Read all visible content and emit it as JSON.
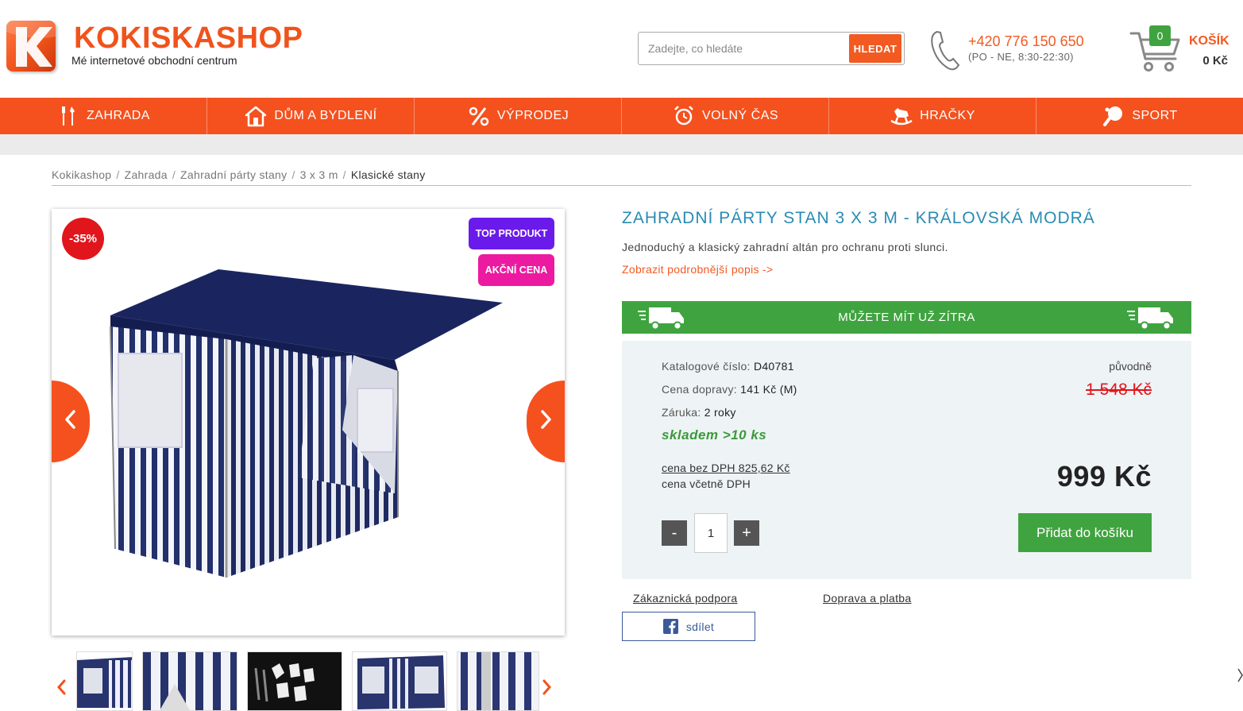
{
  "header": {
    "logo_name": "KOKISKASHOP",
    "logo_tagline": "Mé internetové obchodní centrum",
    "search_placeholder": "Zadejte, co hledáte",
    "search_button": "HLEDAT",
    "phone": "+420 776 150 650",
    "phone_hours": "(PO - NE, 8:30-22:30)",
    "cart_count": "0",
    "cart_label": "KOŠÍK",
    "cart_total": "0 Kč"
  },
  "nav": [
    {
      "label": "ZAHRADA",
      "icon": "garden-tools-icon"
    },
    {
      "label": "DŮM A BYDLENÍ",
      "icon": "house-icon"
    },
    {
      "label": "VÝPRODEJ",
      "icon": "percent-icon"
    },
    {
      "label": "VOLNÝ ČAS",
      "icon": "alarm-clock-icon"
    },
    {
      "label": "HRAČKY",
      "icon": "rocking-horse-icon"
    },
    {
      "label": "SPORT",
      "icon": "ping-pong-icon"
    }
  ],
  "breadcrumb": [
    "Kokikashop",
    "Zahrada",
    "Zahradní párty stany",
    "3 x 3 m",
    "Klasické stany"
  ],
  "gallery": {
    "discount_badge": "-35%",
    "top_badge": "TOP PRODUKT",
    "action_badge": "AKČNÍ CENA",
    "prev_icon": "chevron-left-icon",
    "next_icon": "chevron-right-icon"
  },
  "product": {
    "title": "ZAHRADNÍ PÁRTY STAN 3 X 3 M - KRÁLOVSKÁ MODRÁ",
    "short_description": "Jednoduchý a klasický zahradní altán pro ochranu proti slunci.",
    "more_link": "Zobrazit podrobnější popis ->",
    "delivery_banner": "MŮŽETE MÍT UŽ ZÍTRA",
    "catalog_label": "Katalogové číslo:",
    "catalog_value": "D40781",
    "shipping_label": "Cena dopravy:",
    "shipping_value": "141 Kč (M)",
    "warranty_label": "Záruka:",
    "warranty_value": "2 roky",
    "stock": "skladem >10 ks",
    "original_label": "původně",
    "original_price": "1 548 Kč",
    "price_no_vat": "cena bez DPH 825,62 Kč",
    "price_vat_label": "cena včetně DPH",
    "price": "999 Kč",
    "qty_minus": "-",
    "qty_value": "1",
    "qty_plus": "+",
    "add_to_cart": "Přidat do košíku",
    "support_link": "Zákaznická podpora",
    "shipping_link": "Doprava a platba",
    "share_label": "sdílet"
  },
  "colors": {
    "brand_orange": "#f4511e",
    "green": "#3fa43f",
    "title_blue": "#2a8bb3",
    "sale_red": "#e0161c",
    "badge_purple": "#6b1aec",
    "badge_pink": "#ec1aa0"
  }
}
